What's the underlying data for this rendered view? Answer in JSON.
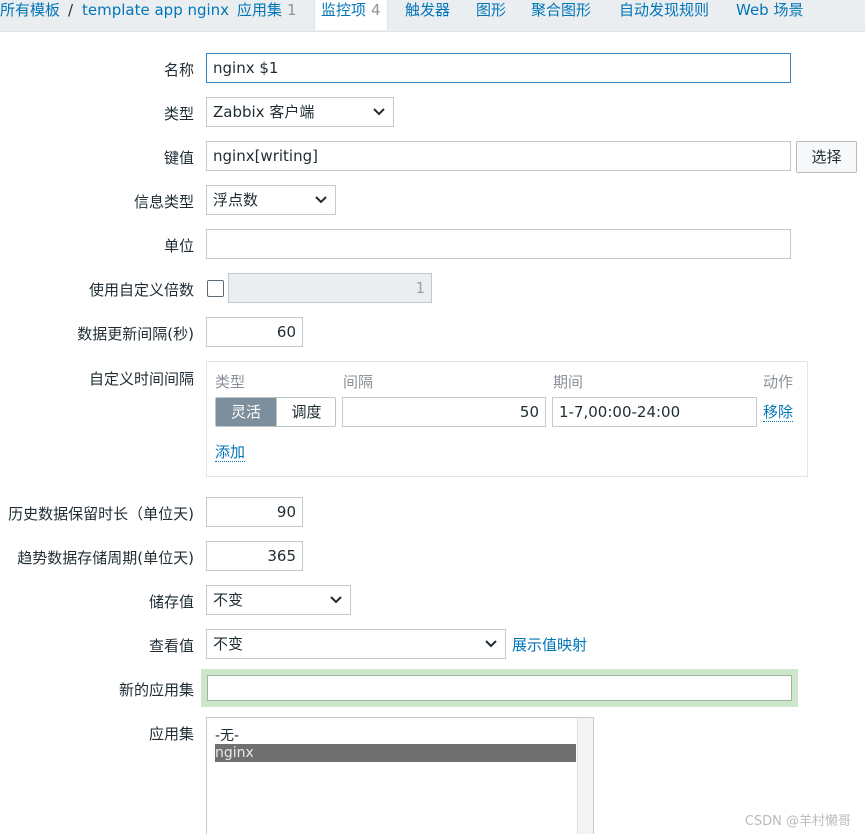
{
  "nav": {
    "all_templates": "所有模板",
    "separator": "/",
    "template_name": "template app nginx",
    "applications": {
      "label": "应用集",
      "count": "1"
    },
    "items": {
      "label": "监控项",
      "count": "4"
    },
    "triggers": "触发器",
    "graphs": "图形",
    "screens": "聚合图形",
    "discovery": "自动发现规则",
    "web": "Web 场景"
  },
  "form": {
    "name": {
      "label": "名称",
      "value": "nginx $1"
    },
    "type": {
      "label": "类型",
      "value": "Zabbix 客户端"
    },
    "key": {
      "label": "键值",
      "value": "nginx[writing]",
      "select_button": "选择"
    },
    "info_type": {
      "label": "信息类型",
      "value": "浮点数"
    },
    "units": {
      "label": "单位",
      "value": ""
    },
    "multiplier": {
      "label": "使用自定义倍数",
      "checked": false,
      "value": "1"
    },
    "update_interval": {
      "label": "数据更新间隔(秒)",
      "value": "60"
    },
    "custom_intervals": {
      "label": "自定义时间间隔",
      "headers": {
        "type": "类型",
        "interval": "间隔",
        "period": "期间",
        "action": "动作"
      },
      "row": {
        "flexible": "灵活",
        "scheduling": "调度",
        "interval": "50",
        "period": "1-7,00:00-24:00",
        "remove": "移除"
      },
      "add": "添加"
    },
    "history": {
      "label": "历史数据保留时长（单位天)",
      "value": "90"
    },
    "trends": {
      "label": "趋势数据存储周期(单位天)",
      "value": "365"
    },
    "store_value": {
      "label": "储存值",
      "value": "不变"
    },
    "show_value": {
      "label": "查看值",
      "value": "不变",
      "mapping_link": "展示值映射"
    },
    "new_application": {
      "label": "新的应用集",
      "value": ""
    },
    "applications": {
      "label": "应用集",
      "options": [
        "-无-",
        "nginx"
      ],
      "selected": "nginx"
    }
  },
  "watermark": "CSDN @羊村懒哥"
}
